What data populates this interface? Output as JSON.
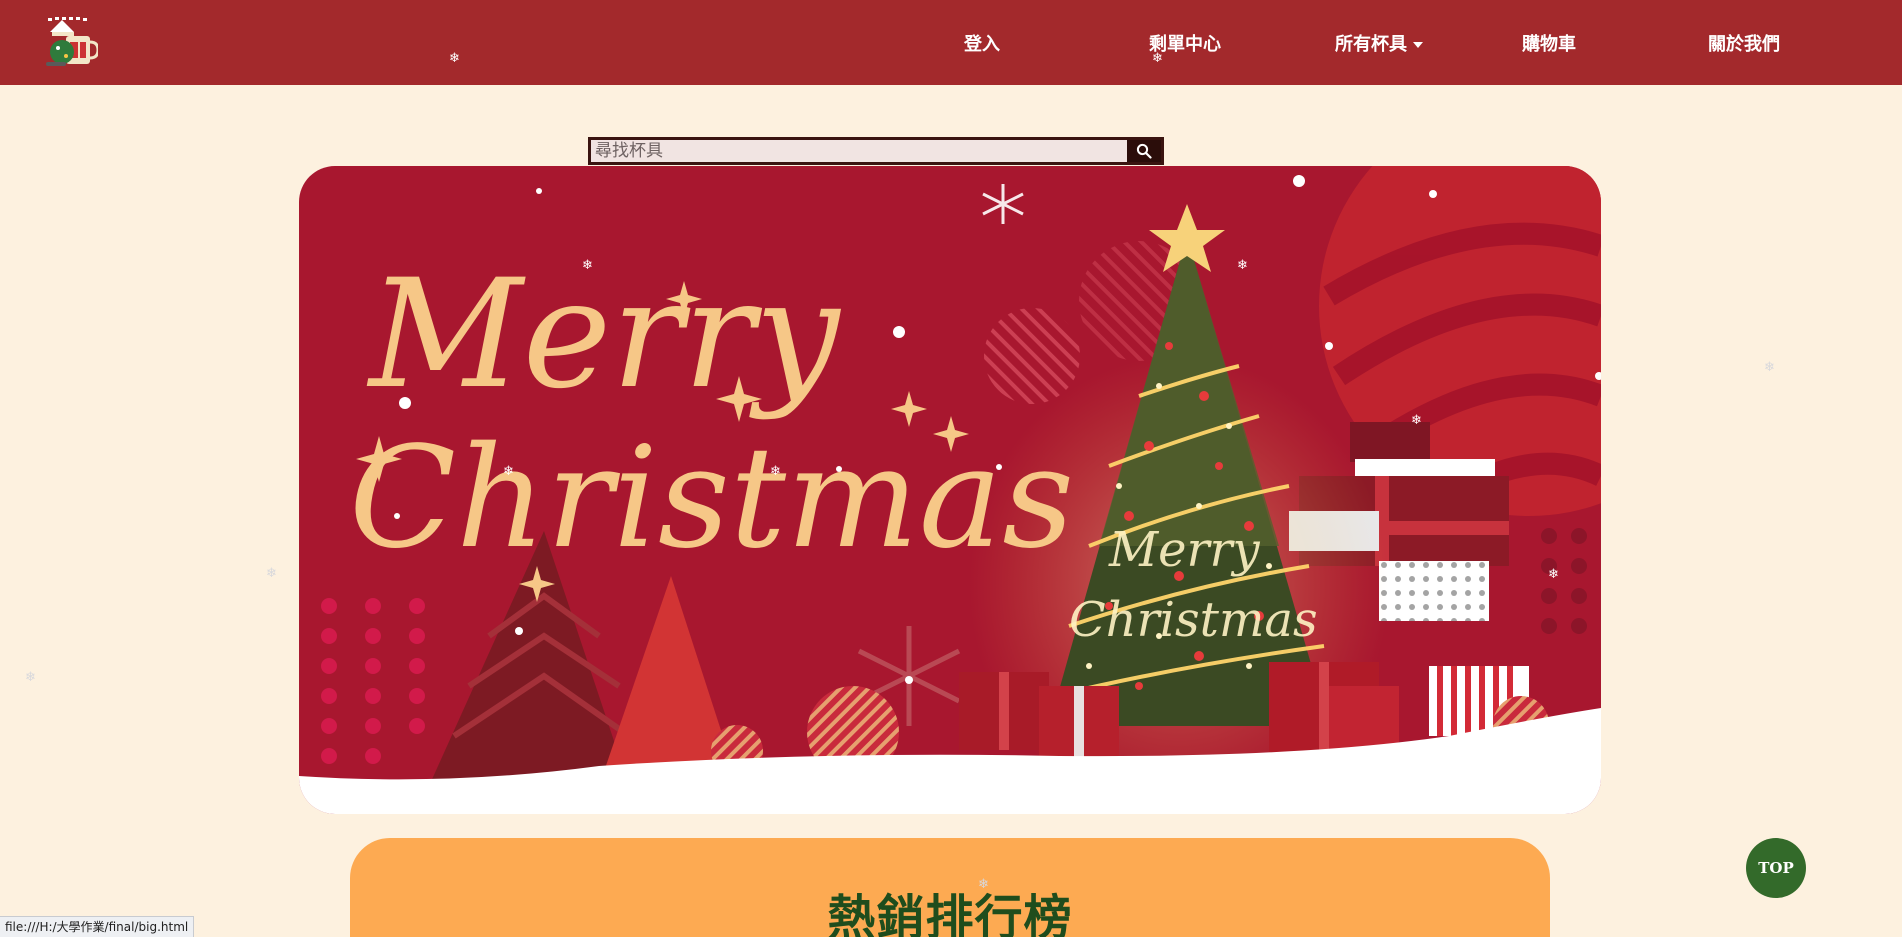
{
  "nav": {
    "items": [
      {
        "label": "登入"
      },
      {
        "label": "剩單中心"
      },
      {
        "label": "所有杯具"
      },
      {
        "label": "購物車"
      },
      {
        "label": "關於我們"
      }
    ]
  },
  "search": {
    "placeholder": "尋找杯具"
  },
  "banner": {
    "line1": "Merry",
    "line2": "Christmas",
    "tree_line1": "Merry",
    "tree_line2": "Christmas"
  },
  "ranking": {
    "title": "熱銷排行榜"
  },
  "top_button": {
    "label": "TOP"
  },
  "statusbar": {
    "url": "file:///H:/大學作業/final/big.html"
  },
  "colors": {
    "navbar": "#a3292c",
    "page_bg": "#fdf1df",
    "banner_red": "#a8172f",
    "ranking_bg": "#fdaa52",
    "ranking_title": "#1f4d1d",
    "top_button": "#336a2a"
  }
}
